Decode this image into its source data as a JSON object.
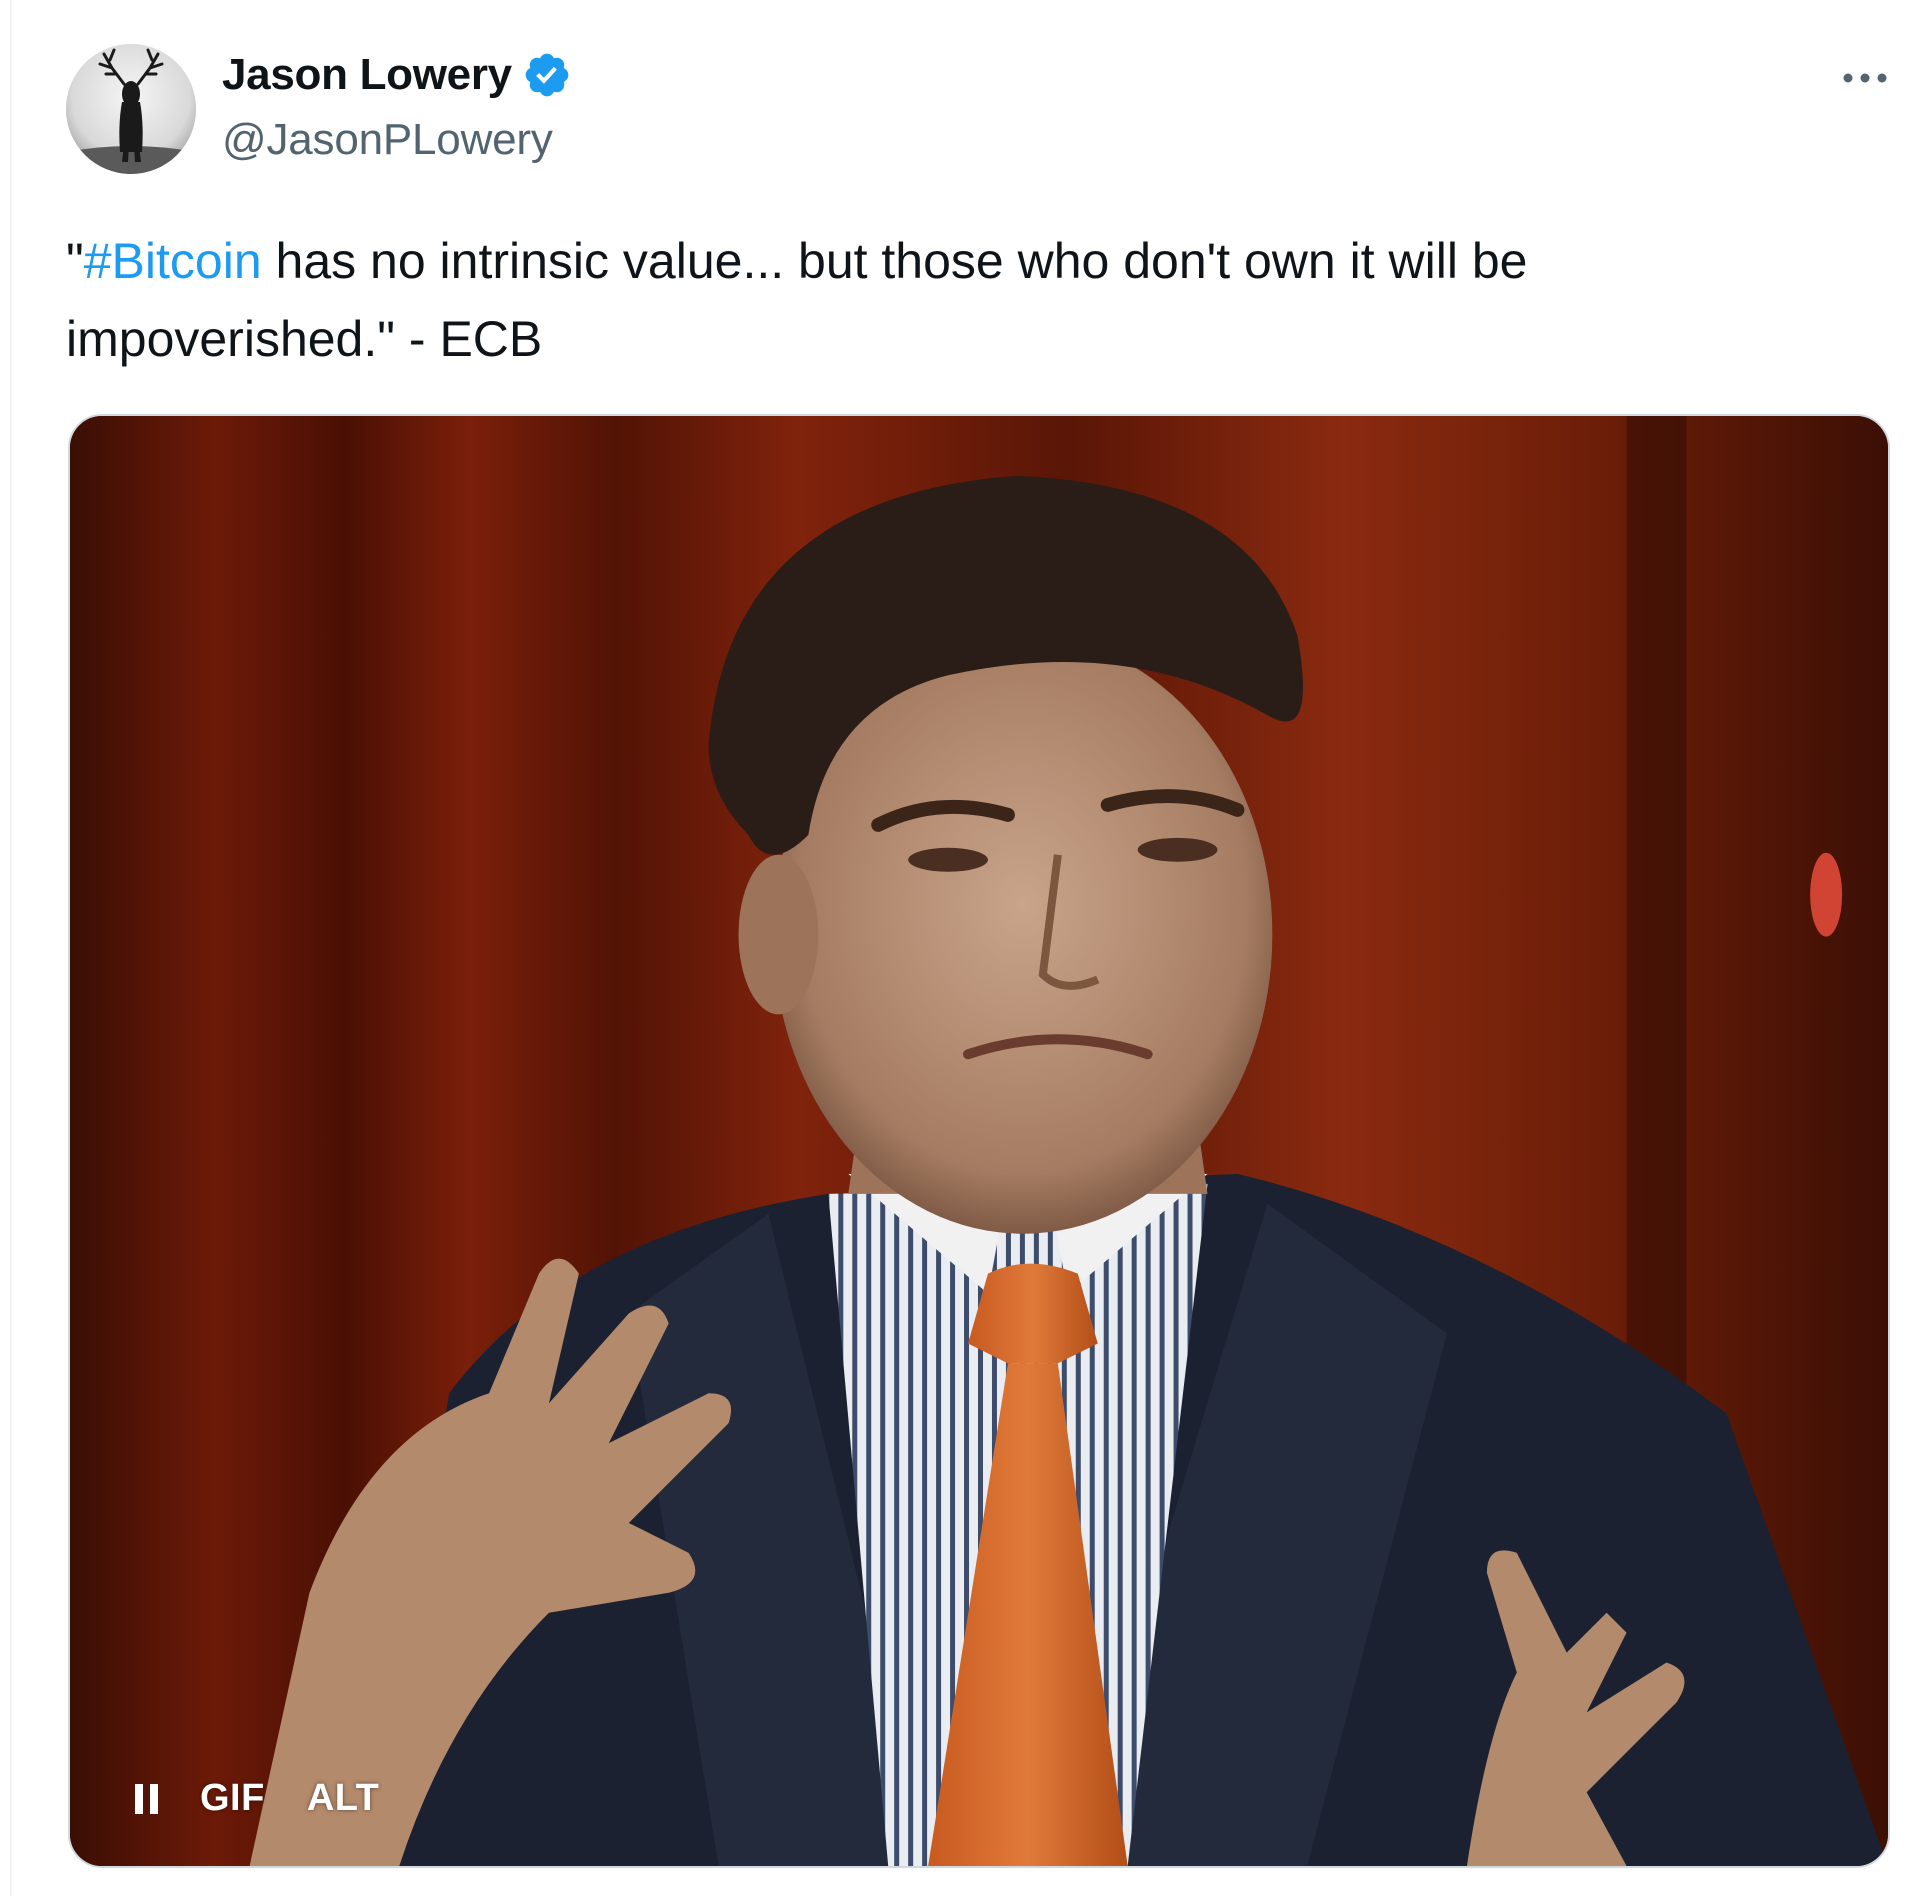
{
  "tweet": {
    "display_name": "Jason Lowery",
    "handle": "@JasonPLowery",
    "verified": true,
    "text_prefix": "\"",
    "hashtag": "#Bitcoin",
    "text_line_1_rest": " has no intrinsic value... but those who don't own it will be",
    "text_line_2": "impoverished.\" - ECB",
    "more_icon": "more-horizontal-icon"
  },
  "media": {
    "type": "gif",
    "pause_icon": "pause-icon",
    "gif_label": "GIF",
    "alt_label": "ALT"
  },
  "colors": {
    "accent": "#1d9bf0",
    "text_primary": "#0f1419",
    "text_secondary": "#536471"
  }
}
